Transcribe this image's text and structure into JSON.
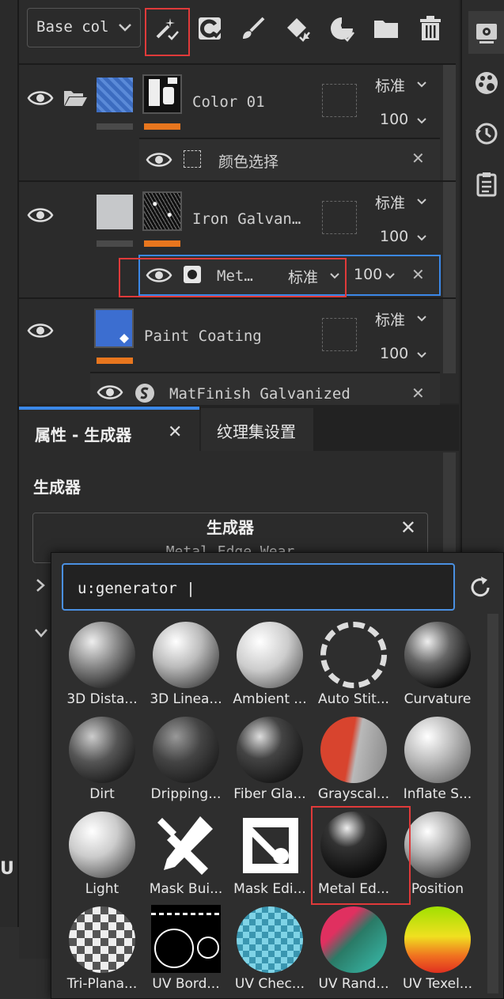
{
  "toolbar": {
    "channel_select": "Base col",
    "icons": [
      "magic-wand-icon",
      "fill-layer-icon",
      "paint-brush-icon",
      "bucket-fill-icon",
      "smart-material-icon",
      "folder-icon",
      "trash-icon"
    ]
  },
  "right_dock": {
    "icons": [
      "settings-icon",
      "palette-icon",
      "history-icon",
      "clipboard-icon"
    ]
  },
  "layers": {
    "layer1": {
      "name": "Color 01",
      "blend": "标准",
      "opacity": "100",
      "effect_name": "颜色选择"
    },
    "layer2": {
      "name": "Iron Galvan…",
      "blend": "标准",
      "opacity": "100",
      "effect_name": "Met…",
      "effect_blend": "标准",
      "effect_opacity": "100"
    },
    "layer3": {
      "name": "Paint Coating",
      "blend": "标准",
      "opacity": "100",
      "effect_name": "MatFinish Galvanized"
    }
  },
  "tabs": {
    "properties": "属性 - 生成器",
    "texture_set": "纹理集设置"
  },
  "properties": {
    "section_title": "生成器",
    "box_title": "生成器",
    "box_value": "Metal Edge Wear"
  },
  "popup": {
    "search_value": "u:generator |",
    "items": [
      {
        "label": "3D Dista..."
      },
      {
        "label": "3D Linea..."
      },
      {
        "label": "Ambient ..."
      },
      {
        "label": "Auto Stit..."
      },
      {
        "label": "Curvature"
      },
      {
        "label": "Dirt"
      },
      {
        "label": "Dripping..."
      },
      {
        "label": "Fiber Gla..."
      },
      {
        "label": "Grayscal..."
      },
      {
        "label": "Inflate S..."
      },
      {
        "label": "Light"
      },
      {
        "label": "Mask Bui..."
      },
      {
        "label": "Mask Edi..."
      },
      {
        "label": "Metal Ed..."
      },
      {
        "label": "Position"
      },
      {
        "label": "Tri-Plana..."
      },
      {
        "label": "UV Bord..."
      },
      {
        "label": "UV Chec..."
      },
      {
        "label": "UV Rand..."
      },
      {
        "label": "UV Texel..."
      }
    ]
  },
  "left_edge_letter": "U"
}
